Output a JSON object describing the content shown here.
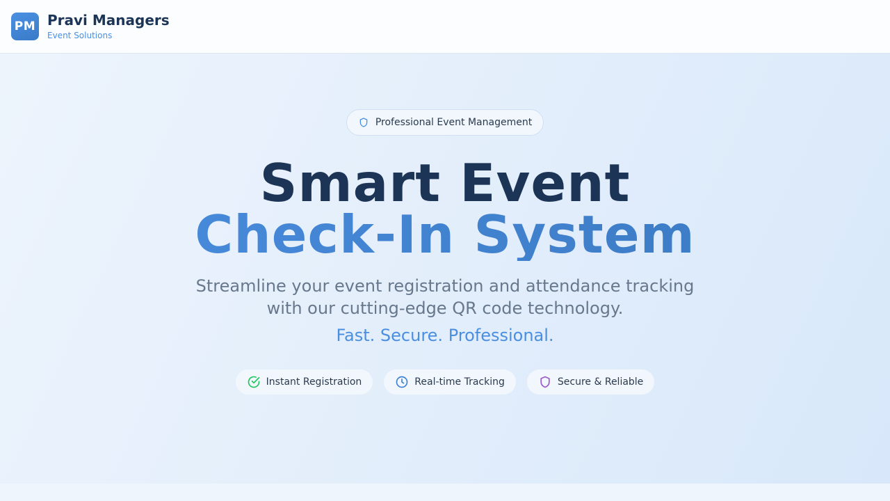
{
  "header": {
    "logo_text": "PM",
    "brand_name": "Pravi Managers",
    "brand_subtitle": "Event Solutions"
  },
  "hero": {
    "badge": {
      "icon": "shield-icon",
      "label": "Professional Event Management"
    },
    "title_line1": "Smart Event",
    "title_line2": "Check-In System",
    "description_line1": "Streamline your event registration and attendance tracking",
    "description_line2": "with our cutting-edge QR code technology.",
    "tagline": "Fast. Secure. Professional.",
    "features": [
      {
        "icon": "check-circle-icon",
        "label": "Instant Registration",
        "color": "#22c55e"
      },
      {
        "icon": "clock-icon",
        "label": "Real-time Tracking",
        "color": "#3b82d6"
      },
      {
        "icon": "shield-icon",
        "label": "Secure & Reliable",
        "color": "#9b59d0"
      }
    ]
  },
  "colors": {
    "brand_dark": "#1c3557",
    "accent_blue": "#4a90e2",
    "muted_text": "#67788d"
  }
}
